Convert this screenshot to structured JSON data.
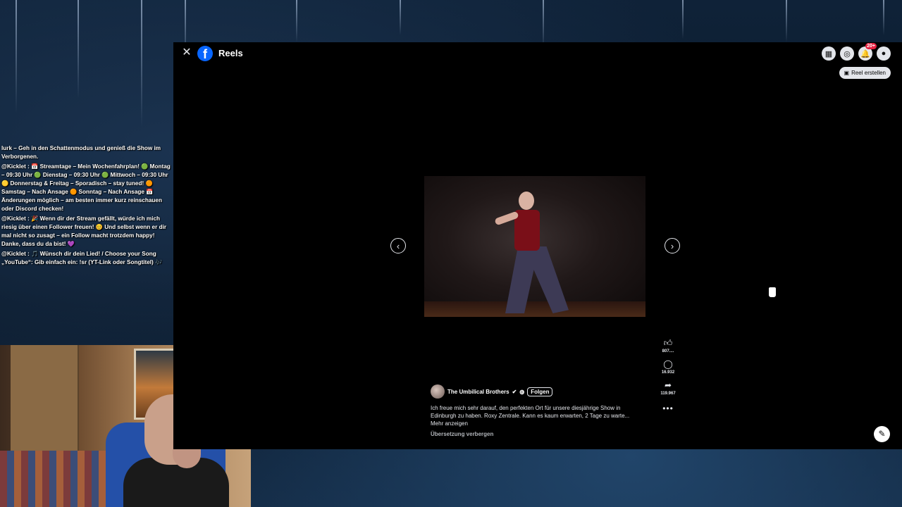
{
  "window": {
    "title": "Reels",
    "notification_count": "20+",
    "create_reel_label": "Reel erstellen"
  },
  "chat": {
    "lines": [
      "lurk – Geh in den Schattenmodus und genieß die Show im Verborgenen.",
      "@Kicklet : 📅 Streamtage – Mein Wochenfahrplan! 🟢 Montag – 09:30 Uhr 🟢 Dienstag – 09:30 Uhr 🟢 Mittwoch – 09:30 Uhr 🟡 Donnerstag & Freitag – Sporadisch – stay tuned! 🟠 Samstag – Nach Ansage 🟠 Sonntag – Nach Ansage 📅 Änderungen möglich – am besten immer kurz reinschauen oder Discord checken!",
      "@Kicklet : 🎉 Wenn dir der Stream gefällt, würde ich mich riesig über einen Follower freuen! 😊 Und selbst wenn er dir mal nicht so zusagt – ein Follow macht trotzdem happy! Danke, dass du da bist! 💜",
      "@Kicklet : 🎵 Wünsch dir dein Lied! / Choose your Song „YouTube“: Gib einfach ein: !sr (YT-Link oder Songtitel) 🎶"
    ]
  },
  "reel": {
    "author": "The Umbilical Brothers",
    "follow_label": "Folgen",
    "caption": "Ich freue mich sehr darauf, den perfekten Ort für unsere diesjährige Show in Edinburgh zu haben. Roxy Zentrale. Kann es kaum erwarten, 2 Tage zu warte... Mehr anzeigen",
    "hide_translation_label": "Übersetzung verbergen",
    "likes": "807....",
    "comments": "16.932",
    "shares": "119.967"
  },
  "icons": {
    "close": "close-icon",
    "facebook": "facebook-logo",
    "menu": "grid-menu-icon",
    "messenger": "messenger-icon",
    "notifications": "bell-icon",
    "profile": "profile-icon",
    "prev": "chevron-left-icon",
    "next": "chevron-right-icon",
    "like": "thumbs-up-icon",
    "comment": "comment-icon",
    "share": "share-icon",
    "more": "more-dots-icon",
    "edit": "edit-icon"
  },
  "colors": {
    "facebook_blue": "#0866ff",
    "badge_red": "#e41e3f",
    "panel_black": "#000000"
  }
}
